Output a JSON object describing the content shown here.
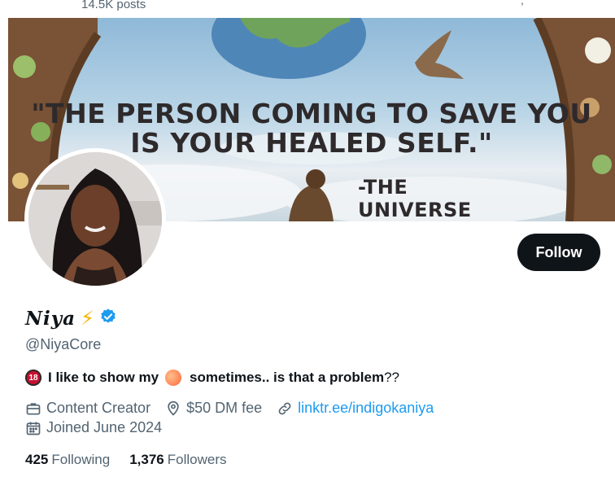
{
  "header": {
    "posts_count": "14.5K posts"
  },
  "banner": {
    "quote_line1": "\"THE PERSON COMING TO SAVE YOU",
    "quote_line2": "IS YOUR HEALED SELF.\"",
    "attribution": "-THE UNIVERSE"
  },
  "profile": {
    "display_name": "Niya",
    "emoji": "⚡",
    "handle": "@NiyaCore",
    "follow_label": "Follow",
    "bio": {
      "part1": "I like to show my",
      "part2": "sometimes.. is that a problem",
      "part3": "??"
    },
    "category": "Content Creator",
    "location": "$50 DM fee",
    "website": "linktr.ee/indigokaniya",
    "joined": "Joined June 2024",
    "following_count": "425",
    "following_label": "Following",
    "followers_count": "1,376",
    "followers_label": "Followers"
  },
  "colors": {
    "accent": "#1d9bf0",
    "text": "#0f1419",
    "muted": "#536471",
    "button": "#0f1419"
  }
}
